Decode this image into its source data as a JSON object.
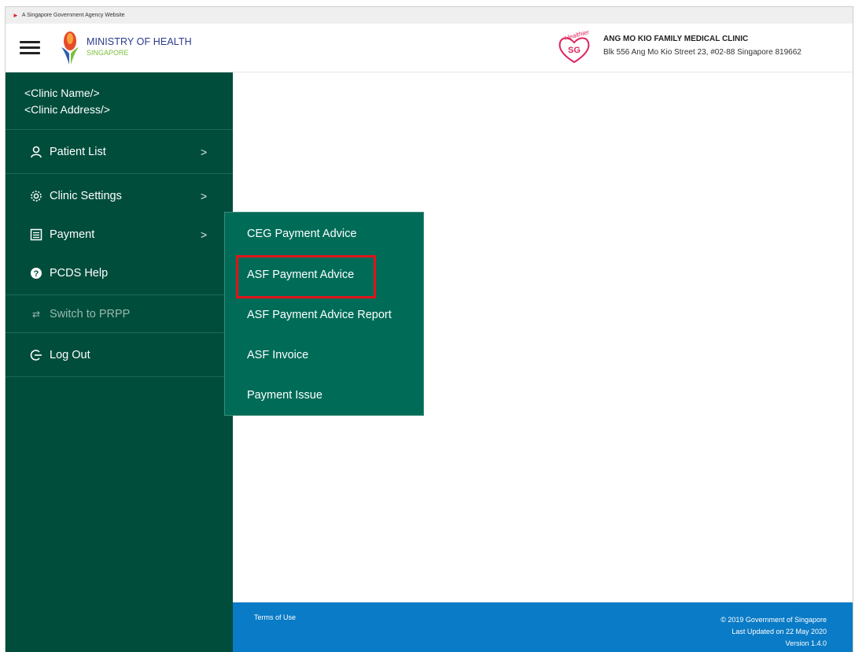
{
  "gov_bar": {
    "text": "A Singapore Government Agency Website"
  },
  "header": {
    "moh_title": "MINISTRY OF HEALTH",
    "moh_subtitle": "SINGAPORE",
    "clinic_name": "ANG MO KIO FAMILY MEDICAL CLINIC",
    "clinic_address": "Blk 556 Ang Mo Kio Street 23, #02-88 Singapore 819662"
  },
  "sidebar": {
    "clinic_name_placeholder": "<Clinic Name/>",
    "clinic_address_placeholder": "<Clinic Address/>",
    "items": [
      {
        "label": "Patient List",
        "icon": "user-icon",
        "chevron": ">"
      },
      {
        "label": "Clinic Settings",
        "icon": "gear-icon",
        "chevron": ">"
      },
      {
        "label": "Payment",
        "icon": "document-icon",
        "chevron": ">"
      },
      {
        "label": "PCDS Help",
        "icon": "help-icon"
      },
      {
        "label": "Switch to PRPP",
        "icon": "switch-icon"
      },
      {
        "label": "Log Out",
        "icon": "logout-icon"
      }
    ]
  },
  "payment_submenu": {
    "items": [
      "CEG Payment Advice",
      "ASF Payment Advice",
      "ASF Payment Advice Report",
      "ASF Invoice",
      "Payment Issue"
    ],
    "highlighted": "ASF Payment Advice",
    "highlight_color": "#e0141b"
  },
  "footer": {
    "terms": "Terms of Use",
    "copyright": "© 2019 Government of Singapore",
    "last_updated": "Last Updated on 22 May 2020",
    "version": "Version 1.4.0"
  },
  "colors": {
    "sidebar_bg": "#004d3c",
    "submenu_bg": "#006c58",
    "footer_bg": "#0a7bc6"
  }
}
